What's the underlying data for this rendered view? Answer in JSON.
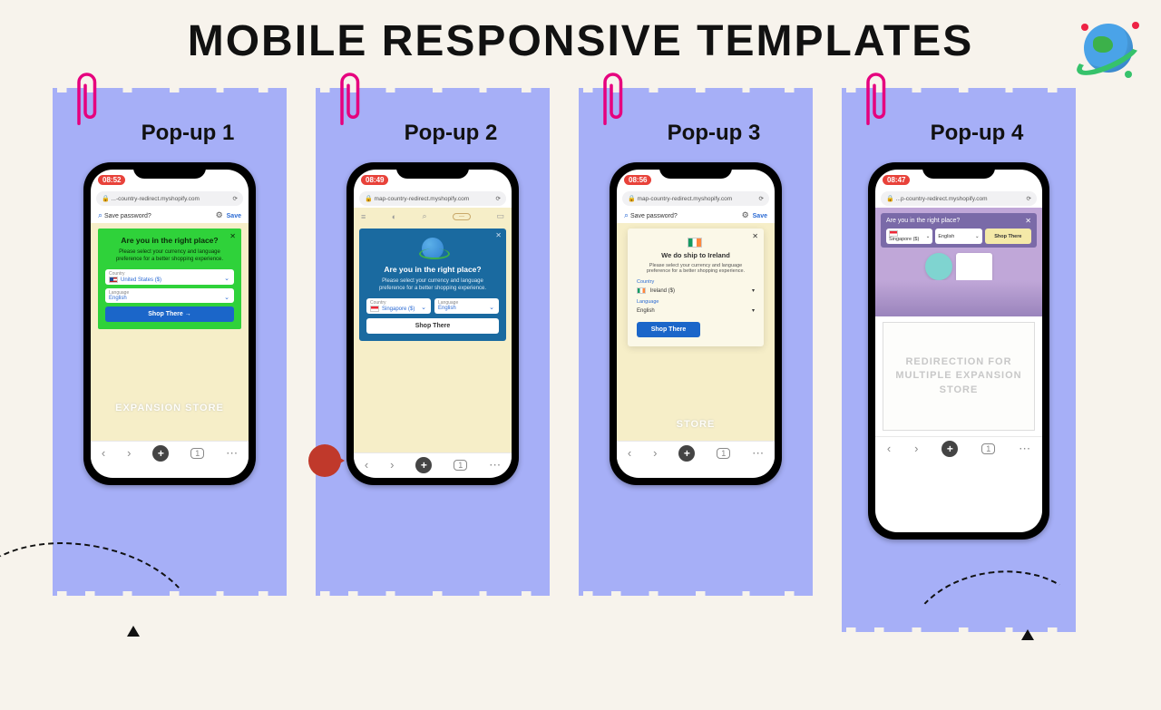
{
  "title": "MOBILE RESPONSIVE TEMPLATES",
  "cards": [
    {
      "label": "Pop-up 1",
      "time": "08:52",
      "url": "...-country-redirect.myshopify.com",
      "save_prompt": "Save password?",
      "save_btn": "Save",
      "popup": {
        "heading": "Are you in the right place?",
        "sub": "Please select your currency and language preference for a better shopping experience.",
        "country_label": "Country",
        "country_value": "United States ($)",
        "language_label": "Language",
        "language_value": "English",
        "cta": "Shop There  →"
      },
      "banner": "EXPANSION STORE"
    },
    {
      "label": "Pop-up 2",
      "time": "08:49",
      "url": "map-country-redirect.myshopify.com",
      "popup": {
        "heading": "Are you in the right place?",
        "sub": "Please select your currency and language preference for a better shopping experience.",
        "country_label": "Country",
        "country_value": "Singapore ($)",
        "language_label": "Language",
        "language_value": "English",
        "cta": "Shop There"
      }
    },
    {
      "label": "Pop-up 3",
      "time": "08:56",
      "url": "map-country-redirect.myshopify.com",
      "save_prompt": "Save password?",
      "save_btn": "Save",
      "popup": {
        "heading": "We do ship to Ireland",
        "sub": "Please select your currency and language preference for a better shopping experience.",
        "country_label": "Country",
        "country_value": "Ireland ($)",
        "language_label": "Language",
        "language_value": "English",
        "cta": "Shop There"
      },
      "banner": "STORE"
    },
    {
      "label": "Pop-up 4",
      "time": "08:47",
      "url": "...p-country-redirect.myshopify.com",
      "bar": {
        "heading": "Are you in the right place?",
        "country": "Singapore ($)",
        "language": "English",
        "cta": "Shop There"
      },
      "redir_text": "REDIRECTION FOR MULTIPLE EXPANSION STORE"
    }
  ],
  "nav": {
    "back": "‹",
    "fwd": "›",
    "plus": "+",
    "tabs": "1",
    "more": "⋯"
  }
}
